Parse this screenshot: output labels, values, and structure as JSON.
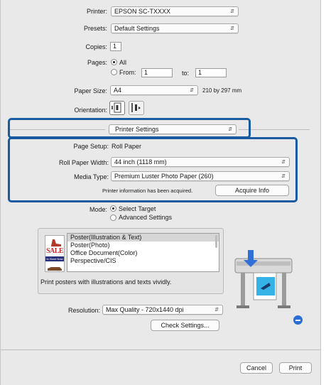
{
  "printer": {
    "label": "Printer:",
    "value": "EPSON SC-TXXXX"
  },
  "presets": {
    "label": "Presets:",
    "value": "Default Settings"
  },
  "copies": {
    "label": "Copies:",
    "value": "1"
  },
  "pages": {
    "label": "Pages:",
    "all_label": "All",
    "from_label": "From:",
    "from_value": "1",
    "to_label": "to:",
    "to_value": "1",
    "selected": "All"
  },
  "paper_size": {
    "label": "Paper Size:",
    "value": "A4",
    "dimensions": "210 by 297 mm"
  },
  "orientation": {
    "label": "Orientation:"
  },
  "panel_menu": {
    "value": "Printer Settings"
  },
  "page_setup": {
    "label": "Page Setup:",
    "value": "Roll Paper"
  },
  "roll_paper_width": {
    "label": "Roll Paper Width:",
    "value": "44 inch (1118 mm)"
  },
  "media_type": {
    "label": "Media Type:",
    "value": "Premium Luster Photo Paper (260)"
  },
  "printer_info": {
    "status": "Printer information has been acquired.",
    "acquire_label": "Acquire Info"
  },
  "mode": {
    "label": "Mode:",
    "option1": "Select Target",
    "option2": "Advanced Settings",
    "selected": "Select Target"
  },
  "targets": {
    "items": [
      "Poster(Illustration & Text)",
      "Poster(Photo)",
      "Office Document(Color)",
      "Perspective/CIS"
    ],
    "selected_index": 0,
    "description": "Print posters with illustrations and texts vividly.",
    "preview_sale_text": "SALE",
    "preview_store_text": "In Store Now"
  },
  "resolution": {
    "label": "Resolution:",
    "value": "Max Quality - 720x1440 dpi"
  },
  "check_settings_label": "Check Settings...",
  "footer": {
    "cancel_label": "Cancel",
    "print_label": "Print"
  },
  "colors": {
    "highlight": "#1a5aa0",
    "info_badge": "#2a6fd6"
  }
}
